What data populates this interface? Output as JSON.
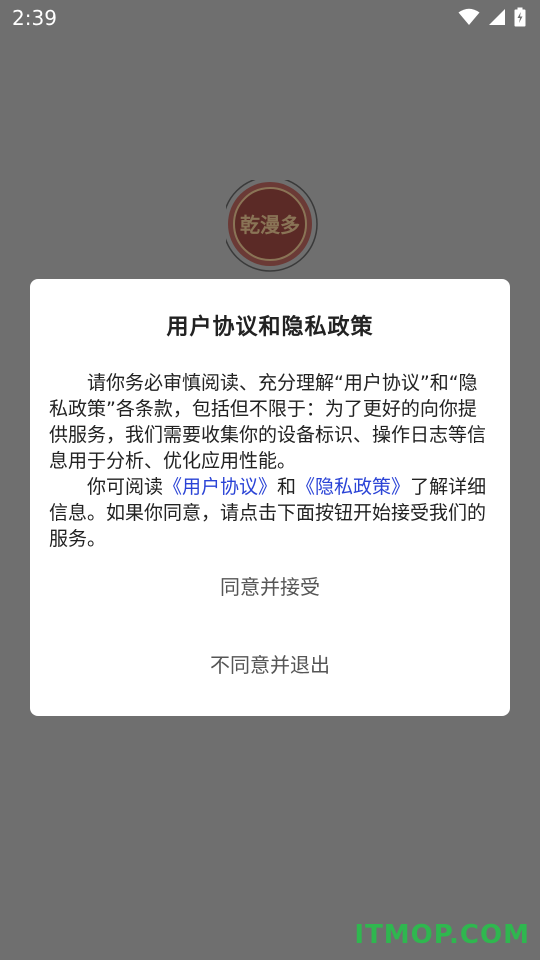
{
  "status_bar": {
    "time": "2:39",
    "icons": [
      "wifi-icon",
      "cellular-signal-icon",
      "battery-charging-icon"
    ]
  },
  "logo": {
    "text": "乾漫多",
    "colors": {
      "ring": "#b62a22",
      "inner": "#8e1e18",
      "gold": "#e5c277"
    }
  },
  "dialog": {
    "title": "用户协议和隐私政策",
    "paragraph1": "请你务必审慎阅读、充分理解“用户协议”和“隐私政策”各条款，包括但不限于：为了更好的向你提供服务，我们需要收集你的设备标识、操作日志等信息用于分析、优化应用性能。",
    "paragraph2": {
      "prefix": "你可阅读",
      "user_agreement_link": "《用户协议》",
      "and": "和",
      "privacy_policy_link": "《隐私政策》",
      "suffix": "了解详细信息。如果你同意，请点击下面按钮开始接受我们的服务。"
    },
    "accept_button": "同意并接受",
    "reject_button": "不同意并退出",
    "link_color": "#2a43d6"
  },
  "watermark": "ITMOP.COM"
}
